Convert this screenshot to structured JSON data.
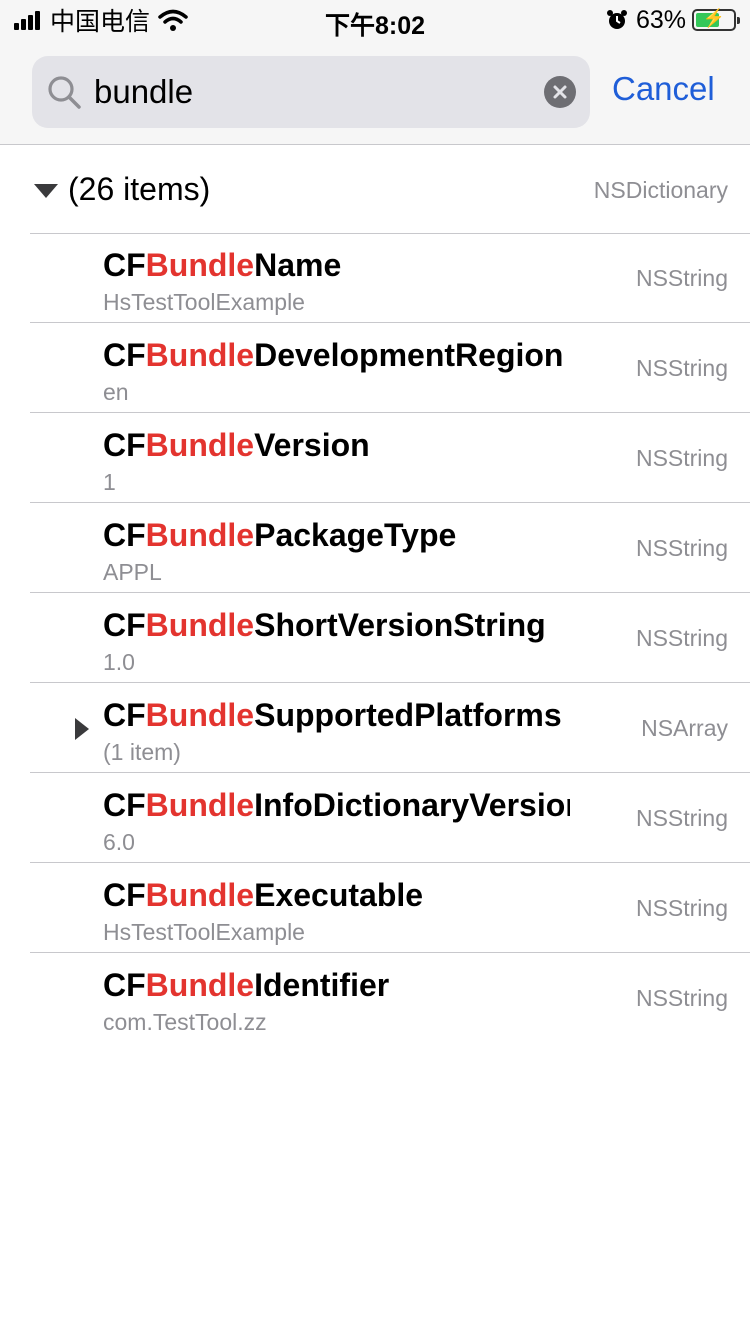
{
  "status_bar": {
    "carrier": "中国电信",
    "time": "下午8:02",
    "battery_percent": "63%",
    "battery_level": 0.63
  },
  "search": {
    "value": "bundle",
    "placeholder": "",
    "cancel_label": "Cancel"
  },
  "root": {
    "title": "(26 items)",
    "type": "NSDictionary"
  },
  "highlight_color": "#e3342f",
  "rows": [
    {
      "prefix": "CF",
      "match": "Bundle",
      "suffix": "Name",
      "value": "HsTestToolExample",
      "type": "NSString",
      "expandable": false
    },
    {
      "prefix": "CF",
      "match": "Bundle",
      "suffix": "DevelopmentRegion",
      "value": "en",
      "type": "NSString",
      "expandable": false
    },
    {
      "prefix": "CF",
      "match": "Bundle",
      "suffix": "Version",
      "value": "1",
      "type": "NSString",
      "expandable": false
    },
    {
      "prefix": "CF",
      "match": "Bundle",
      "suffix": "PackageType",
      "value": "APPL",
      "type": "NSString",
      "expandable": false
    },
    {
      "prefix": "CF",
      "match": "Bundle",
      "suffix": "ShortVersionString",
      "value": "1.0",
      "type": "NSString",
      "expandable": false
    },
    {
      "prefix": "CF",
      "match": "Bundle",
      "suffix": "SupportedPlatforms",
      "value": "(1 item)",
      "type": "NSArray",
      "expandable": true
    },
    {
      "prefix": "CF",
      "match": "Bundle",
      "suffix": "InfoDictionaryVersion",
      "value": "6.0",
      "type": "NSString",
      "expandable": false
    },
    {
      "prefix": "CF",
      "match": "Bundle",
      "suffix": "Executable",
      "value": "HsTestToolExample",
      "type": "NSString",
      "expandable": false
    },
    {
      "prefix": "CF",
      "match": "Bundle",
      "suffix": "Identifier",
      "value": "com.TestTool.zz",
      "type": "NSString",
      "expandable": false
    }
  ]
}
